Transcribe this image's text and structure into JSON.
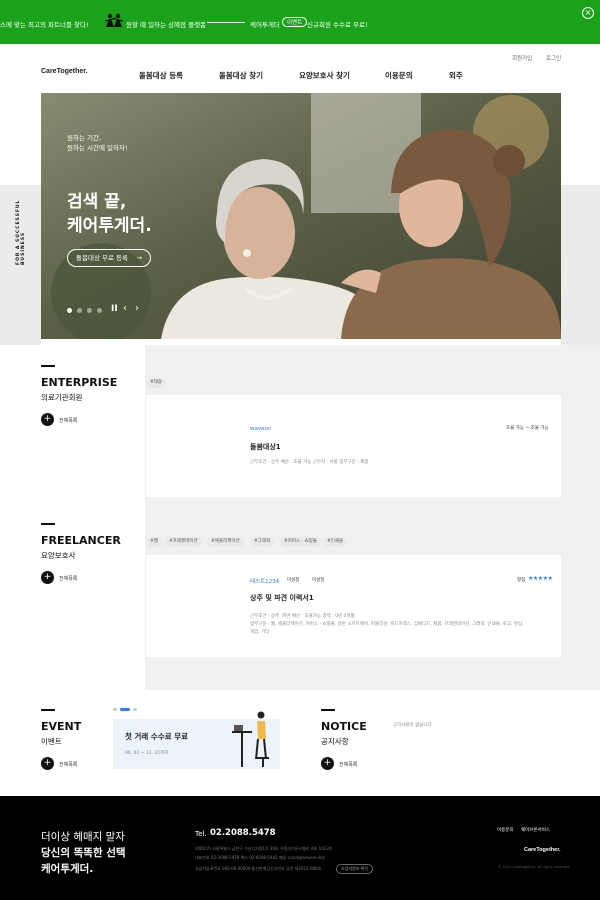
{
  "banner": {
    "part1": "니스에 맞는 최고의 파트너를 찾다!",
    "part2": "원할 때 일하는 상혜점 플랫폼",
    "part3": "케어투게더",
    "pill": "이벤트",
    "part4": "신규회원 수수료 무료!"
  },
  "topbar": {
    "signup": "회원가입",
    "login": "로그인"
  },
  "logo": "CareTogether.",
  "nav": [
    "돌봄대상 등록",
    "돌봄대상 찾기",
    "요양보호사 찾기",
    "이용문의",
    "외주"
  ],
  "side_tag": "FOR A SUCCESSFUL BUSINESS",
  "hero": {
    "small_line1": "원하는 기간,",
    "small_line2": "원하는 시간에 일하자!",
    "headline1": "검색 끝,",
    "headline2": "케어투게더.",
    "cta": "돌봄대상 무료 등록",
    "slide_index": 1,
    "slide_count": 4
  },
  "enterprise": {
    "title": "ENTERPRISE",
    "subtitle": "의료기관회원",
    "more": "전체목록",
    "tags": [
      "#태용"
    ],
    "card": {
      "company": "waveon",
      "status": "조율 가능 ~ 조율 가능",
      "title": "돌봄대상1",
      "meta": "근무조건 : 상주    예산 : 조율 가능    근무지 : 서울    업무구분 : 제품"
    }
  },
  "freelancer": {
    "title": "FREELANCER",
    "subtitle": "요양보호사",
    "more": "전체목록",
    "tags": [
      "#웹",
      "#프레젠테이션",
      "#애플리케이션",
      "#그래픽",
      "#커머스 · 쇼핑몰",
      "#인쇄물"
    ],
    "card": {
      "id": "테스트1234",
      "field1": "미설정",
      "field2": "미설정",
      "rating_label": "평점",
      "rating": 5,
      "title": "상주 및 파견 이력서1",
      "line1": "근무조건 : 상주, 파견        예산 : 조율가능        경력 : 0년 0개월",
      "line2": "업무구분 : 웹, 애플리케이션, 커머스 · 쇼핑몰, 일반 소프트웨어, 퍼블리싱, 워드프레스, 임베디드, 제품, 프레젠테이션, 그래픽, 인쇄물, 로고, 영상,",
      "line3": "게임, 기타"
    }
  },
  "event": {
    "title": "EVENT",
    "subtitle": "이벤트",
    "more": "전체목록",
    "card_title": "첫 거래 수수료 무료",
    "card_date": "06. 01 ~ 12. 31까지"
  },
  "notice": {
    "title": "NOTICE",
    "subtitle": "공지사항",
    "more": "전체목록",
    "empty": "공지사항이 없습니다."
  },
  "footer": {
    "slogan1": "더이상 헤매지 말자",
    "slogan2": "당신의 똑똑한 선택",
    "slogan3": "케어투게더.",
    "tel_label": "Tel.",
    "tel": "02.2088.5478",
    "addr1": "(08507) 서울특별시 금천구 가산디지털1로 168, 우림라이온스밸리 A동 1013호",
    "addr2": "대표번호 02-2088-5478    팩스 02-6008-5442    메일 scoot@waveon.biz",
    "addr3": "사업자등록번호 000-00-00000    통신판매업신고번호 공란 제2022-000호",
    "biz_btn": "사업자정보 확인",
    "link1": "이용문의",
    "link2": "웨이브온서비스",
    "logo": "CareTogether.",
    "copy": "© 2022 caretogether. All rights reserved"
  },
  "colors": {
    "brand_green": "#1aa21a",
    "accent_blue": "#2f7ee0",
    "footer_bg": "#000000"
  }
}
